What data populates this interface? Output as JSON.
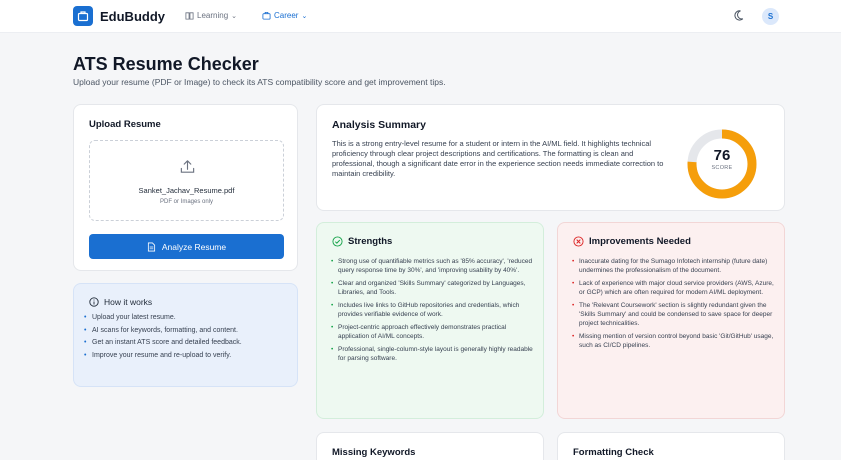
{
  "header": {
    "brand": "EduBuddy",
    "nav": [
      {
        "label": "Learning"
      },
      {
        "label": "Career"
      }
    ],
    "avatar_initial": "S",
    "accent_color": "#1a6fd1"
  },
  "page": {
    "title": "ATS Resume Checker",
    "subtitle": "Upload your resume (PDF or Image) to check its ATS compatibility score and get improvement tips."
  },
  "upload": {
    "title": "Upload Resume",
    "file_name": "Sanket_Jachav_Resume.pdf",
    "file_hint": "PDF or Images only",
    "button_label": "Analyze Resume"
  },
  "how_it_works": {
    "title": "How it works",
    "steps": [
      "Upload your latest resume.",
      "AI scans for keywords, formatting, and content.",
      "Get an instant ATS score and detailed feedback.",
      "Improve your resume and re-upload to verify."
    ]
  },
  "summary": {
    "title": "Analysis Summary",
    "text": "This is a strong entry-level resume for a student or intern in the AI/ML field. It highlights technical proficiency through clear project descriptions and certifications. The formatting is clean and professional, though a significant date error in the experience section needs immediate correction to maintain credibility.",
    "score": 76,
    "score_fraction": 0.76,
    "score_label": "SCORE",
    "gauge_color": "#f59e0b",
    "gauge_track_color": "#e5e7eb"
  },
  "strengths": {
    "title": "Strengths",
    "color": "#16a34a",
    "items": [
      "Strong use of quantifiable metrics such as '85% accuracy', 'reduced query response time by 30%', and 'improving usability by 40%'.",
      "Clear and organized 'Skills Summary' categorized by Languages, Libraries, and Tools.",
      "Includes live links to GitHub repositories and credentials, which provides verifiable evidence of work.",
      "Project-centric approach effectively demonstrates practical application of AI/ML concepts.",
      "Professional, single-column-style layout is generally highly readable for parsing software."
    ]
  },
  "improvements": {
    "title": "Improvements Needed",
    "color": "#dc2626",
    "items": [
      "Inaccurate dating for the Sumago Infotech internship (future date) undermines the professionalism of the document.",
      "Lack of experience with major cloud service providers (AWS, Azure, or GCP) which are often required for modern AI/ML deployment.",
      "The 'Relevant Coursework' section is slightly redundant given the 'Skills Summary' and could be condensed to save space for deeper project technicalities.",
      "Missing mention of version control beyond basic 'Git/GitHub' usage, such as CI/CD pipelines."
    ]
  },
  "missing_keywords": {
    "title": "Missing Keywords"
  },
  "formatting_check": {
    "title": "Formatting Check"
  }
}
